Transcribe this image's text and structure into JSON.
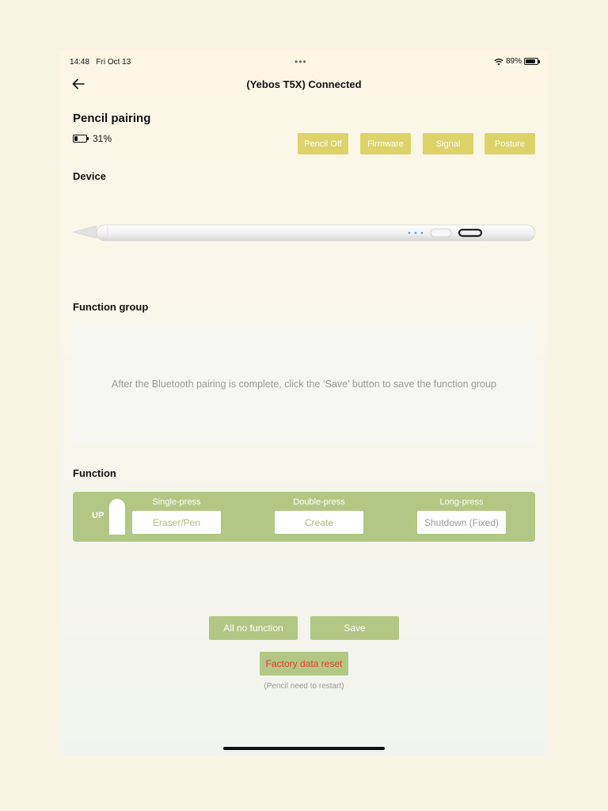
{
  "status_bar": {
    "time": "14:48",
    "date": "Fri Oct 13",
    "battery_percent": "89%",
    "battery_level": 0.89
  },
  "nav": {
    "title": "(Yebos T5X) Connected",
    "back_icon": "arrow-left-icon"
  },
  "pencil": {
    "title": "Pencil pairing",
    "battery_percent": "31%",
    "battery_level": 0.31
  },
  "top_buttons": [
    "Pencil Off",
    "Firmware",
    "Signal",
    "Posture"
  ],
  "sections": {
    "device": "Device",
    "function_group": "Function group",
    "function": "Function"
  },
  "function_group_hint": "After the Bluetooth pairing is complete, click the ‘Save’ button to save the function group",
  "function_panel": {
    "side_label": "UP",
    "columns": [
      {
        "label": "Single-press",
        "value": "Eraser/Pen"
      },
      {
        "label": "Double-press",
        "value": "Create"
      },
      {
        "label": "Long-press",
        "value": "Shutdown (Fixed)"
      }
    ]
  },
  "actions": {
    "all_no_function": "All no function",
    "save": "Save",
    "factory_reset": "Factory data reset",
    "reset_note": "(Pencil need to restart)"
  },
  "colors": {
    "top_button": "#dcd369",
    "green_accent": "#b2c783",
    "reset_text": "#e63c2b",
    "page_background": "#f8f4e4"
  }
}
